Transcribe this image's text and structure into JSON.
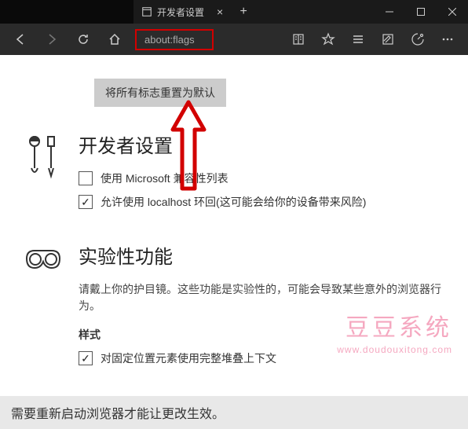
{
  "tab": {
    "title": "开发者设置"
  },
  "address": {
    "url": "about:flags"
  },
  "reset_button": "将所有标志重置为默认",
  "sections": {
    "developer": {
      "title": "开发者设置",
      "options": [
        {
          "label": "使用 Microsoft 兼容性列表",
          "checked": false
        },
        {
          "label": "允许使用 localhost 环回(这可能会给你的设备带来风险)",
          "checked": true
        }
      ]
    },
    "experimental": {
      "title": "实验性功能",
      "desc": "请戴上你的护目镜。这些功能是实验性的，可能会导致某些意外的浏览器行为。",
      "subsection": "样式",
      "options": [
        {
          "label": "对固定位置元素使用完整堆叠上下文",
          "checked": true
        }
      ]
    }
  },
  "footer": "需要重新启动浏览器才能让更改生效。",
  "watermark": {
    "cn": "豆豆系统",
    "url": "www.doudouxitong.com"
  }
}
